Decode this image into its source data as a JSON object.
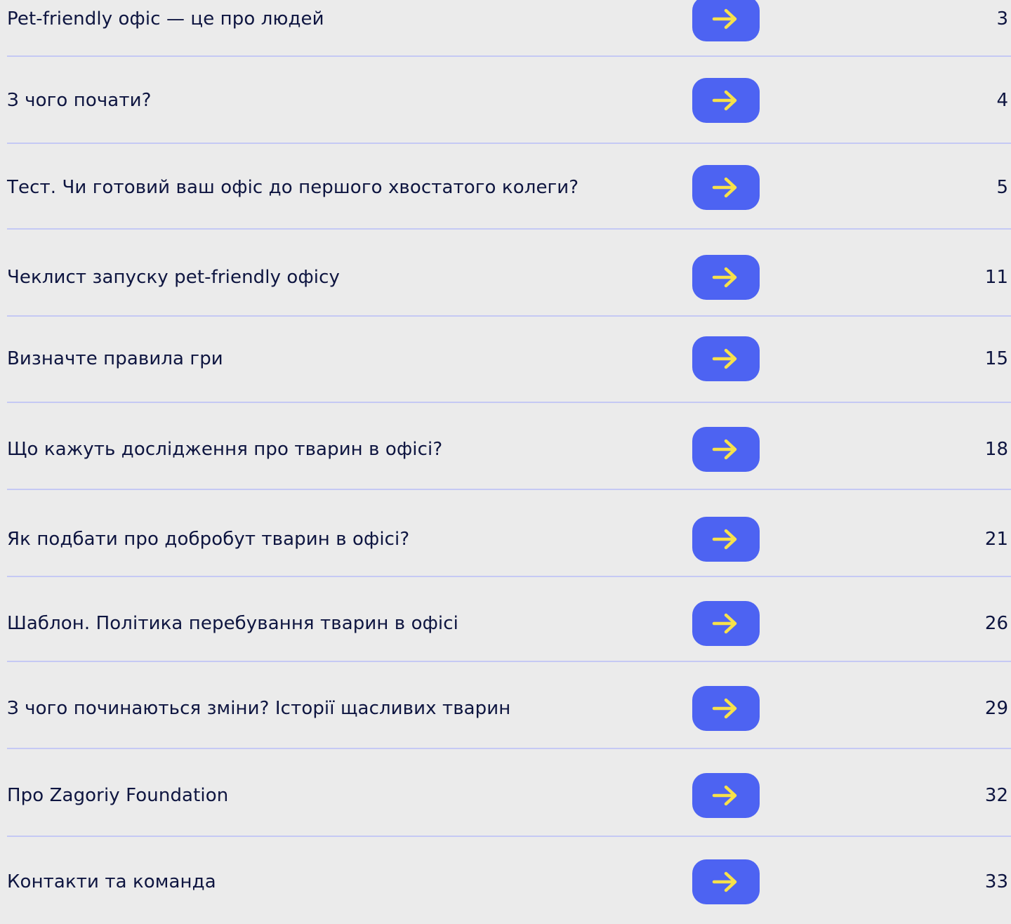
{
  "accent_color": "#4D63F2",
  "arrow_color": "#F7E14B",
  "text_color": "#0E1540",
  "divider_color": "#C5C9F4",
  "background_color": "#EBEBEB",
  "arrow_icon": "arrow-right-icon",
  "entries": [
    {
      "title": "Pet-friendly офіс — це про людей",
      "page": "3"
    },
    {
      "title": "З чого почати?",
      "page": "4"
    },
    {
      "title": "Тест. Чи готовий ваш офіс до першого хвостатого колеги?",
      "page": "5"
    },
    {
      "title": "Чеклист запуску pet-friendly офісу",
      "page": "11"
    },
    {
      "title": "Визначте правила гри",
      "page": "15"
    },
    {
      "title": "Що кажуть дослідження про тварин в офісі?",
      "page": "18"
    },
    {
      "title": "Як подбати про добробут тварин в офісі?",
      "page": "21"
    },
    {
      "title": "Шаблон. Політика перебування тварин в офісі",
      "page": "26"
    },
    {
      "title": "З чого починаються зміни? Історії щасливих тварин",
      "page": "29"
    },
    {
      "title": "Про Zagoriy Foundation",
      "page": "32"
    },
    {
      "title": "Контакти та команда",
      "page": "33"
    }
  ]
}
